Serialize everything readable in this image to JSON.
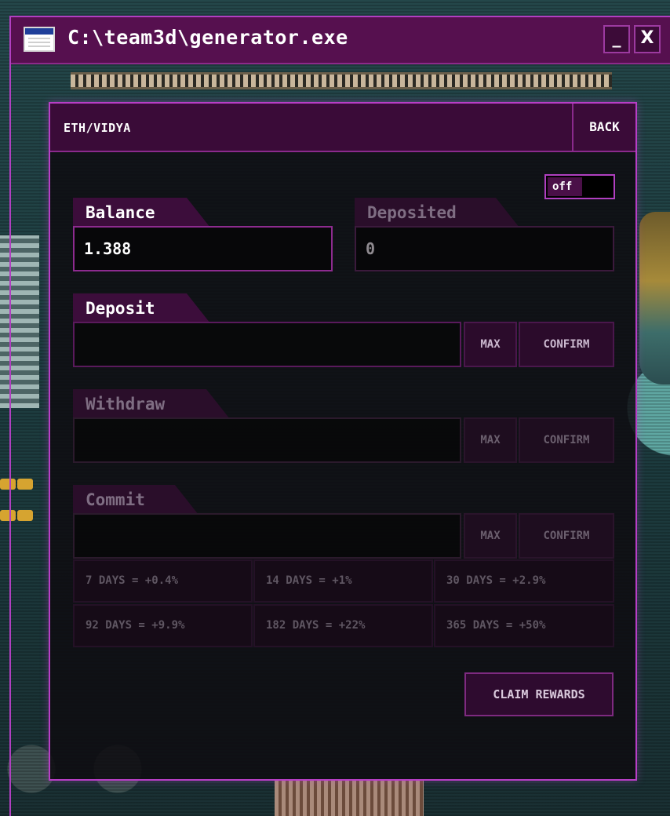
{
  "window": {
    "title": "C:\\team3d\\generator.exe",
    "minimize_label": "_",
    "close_label": "X"
  },
  "panel": {
    "pair": "ETH/VIDYA",
    "back_label": "BACK",
    "toggle_label": "off"
  },
  "balance": {
    "label": "Balance",
    "value": "1.388"
  },
  "deposited": {
    "label": "Deposited",
    "value": "0"
  },
  "deposit": {
    "label": "Deposit",
    "input_value": "",
    "max_label": "MAX",
    "confirm_label": "CONFIRM"
  },
  "withdraw": {
    "label": "Withdraw",
    "input_value": "",
    "max_label": "MAX",
    "confirm_label": "CONFIRM"
  },
  "commit": {
    "label": "Commit",
    "input_value": "",
    "max_label": "MAX",
    "confirm_label": "CONFIRM",
    "options": [
      "7 DAYS = +0.4%",
      "14 DAYS = +1%",
      "30 DAYS = +2.9%",
      "92 DAYS = +9.9%",
      "182 DAYS = +22%",
      "365 DAYS = +50%"
    ]
  },
  "claim_label": "CLAIM REWARDS",
  "colors": {
    "accent": "#b83fc6",
    "titlebar": "#56104f",
    "panel_bg": "#0e0c10"
  }
}
